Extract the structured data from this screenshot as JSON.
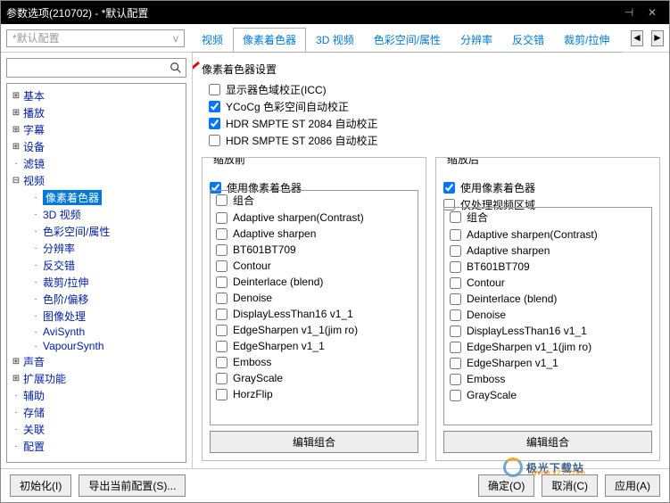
{
  "window": {
    "title": "参数选项(210702) - *默认配置"
  },
  "config_combo": {
    "value": "*默认配置",
    "caret": "v"
  },
  "tabs": {
    "items": [
      "视频",
      "像素着色器",
      "3D 视频",
      "色彩空间/属性",
      "分辨率",
      "反交错",
      "裁剪/拉伸"
    ],
    "active_index": 1
  },
  "tree": {
    "nodes": [
      {
        "label": "基本",
        "exp": "+"
      },
      {
        "label": "播放",
        "exp": "+"
      },
      {
        "label": "字幕",
        "exp": "+"
      },
      {
        "label": "设备",
        "exp": "+"
      },
      {
        "label": "滤镜",
        "exp": ""
      },
      {
        "label": "视频",
        "exp": "-",
        "children": [
          {
            "label": "像素着色器",
            "selected": true
          },
          {
            "label": "3D 视频"
          },
          {
            "label": "色彩空间/属性"
          },
          {
            "label": "分辨率"
          },
          {
            "label": "反交错"
          },
          {
            "label": "裁剪/拉伸"
          },
          {
            "label": "色阶/偏移"
          },
          {
            "label": "图像处理"
          },
          {
            "label": "AviSynth"
          },
          {
            "label": "VapourSynth"
          }
        ]
      },
      {
        "label": "声音",
        "exp": "+"
      },
      {
        "label": "扩展功能",
        "exp": "+"
      },
      {
        "label": "辅助",
        "exp": ""
      },
      {
        "label": "存储",
        "exp": ""
      },
      {
        "label": "关联",
        "exp": ""
      },
      {
        "label": "配置",
        "exp": ""
      }
    ]
  },
  "settings": {
    "group_title": "像素着色器设置",
    "checks": [
      {
        "label": "显示器色域校正(ICC)",
        "checked": false
      },
      {
        "label": "YCoCg 色彩空间自动校正",
        "checked": true
      },
      {
        "label": "HDR SMPTE ST 2084 自动校正",
        "checked": true
      },
      {
        "label": "HDR SMPTE ST 2086 自动校正",
        "checked": false
      }
    ]
  },
  "before": {
    "legend": "缩放前",
    "use_label": "使用像素着色器",
    "use_checked": true,
    "extra_checks": [],
    "items": [
      "组合",
      "Adaptive sharpen(Contrast)",
      "Adaptive sharpen",
      "BT601BT709",
      "Contour",
      "Deinterlace (blend)",
      "Denoise",
      "DisplayLessThan16 v1_1",
      "EdgeSharpen v1_1(jim ro)",
      "EdgeSharpen v1_1",
      "Emboss",
      "GrayScale",
      "HorzFlip"
    ],
    "edit_label": "编辑组合"
  },
  "after": {
    "legend": "缩放后",
    "use_label": "使用像素着色器",
    "use_checked": true,
    "extra_checks": [
      {
        "label": "仅处理视频区域",
        "checked": false
      }
    ],
    "items": [
      "组合",
      "Adaptive sharpen(Contrast)",
      "Adaptive sharpen",
      "BT601BT709",
      "Contour",
      "Deinterlace (blend)",
      "Denoise",
      "DisplayLessThan16 v1_1",
      "EdgeSharpen v1_1(jim ro)",
      "EdgeSharpen v1_1",
      "Emboss",
      "GrayScale"
    ],
    "edit_label": "编辑组合"
  },
  "buttons": {
    "init": "初始化(I)",
    "export": "导出当前配置(S)...",
    "ok": "确定(O)",
    "cancel": "取消(C)",
    "apply": "应用(A)"
  },
  "watermark": {
    "brand": "极光下载站",
    "url": "www.xz7.com"
  }
}
